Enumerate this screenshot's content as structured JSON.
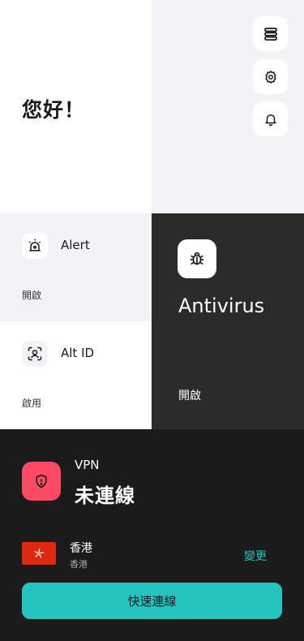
{
  "greeting": "您好！",
  "toolbar": {
    "menu_icon": "list-icon",
    "settings_icon": "gear-icon",
    "notifications_icon": "bell-icon"
  },
  "tiles": {
    "alert": {
      "title": "Alert",
      "status": "開啟",
      "icon": "alarm-icon"
    },
    "altid": {
      "title": "Alt ID",
      "status": "啟用",
      "icon": "face-scan-icon"
    }
  },
  "antivirus": {
    "title": "Antivirus",
    "status": "開啟",
    "icon": "bug-icon"
  },
  "vpn": {
    "label": "VPN",
    "status": "未連線",
    "icon": "shield-icon",
    "location": {
      "name": "香港",
      "sub": "香港",
      "flag": "hong-kong-flag"
    },
    "change_label": "變更",
    "connect_label": "快速連線"
  },
  "colors": {
    "vpn_accent": "#ff4a66",
    "teal": "#25c4bf",
    "dark_panel": "#2b2b2b",
    "vpn_bg": "#1b1b1b",
    "light_bg": "#f2f3f6"
  }
}
